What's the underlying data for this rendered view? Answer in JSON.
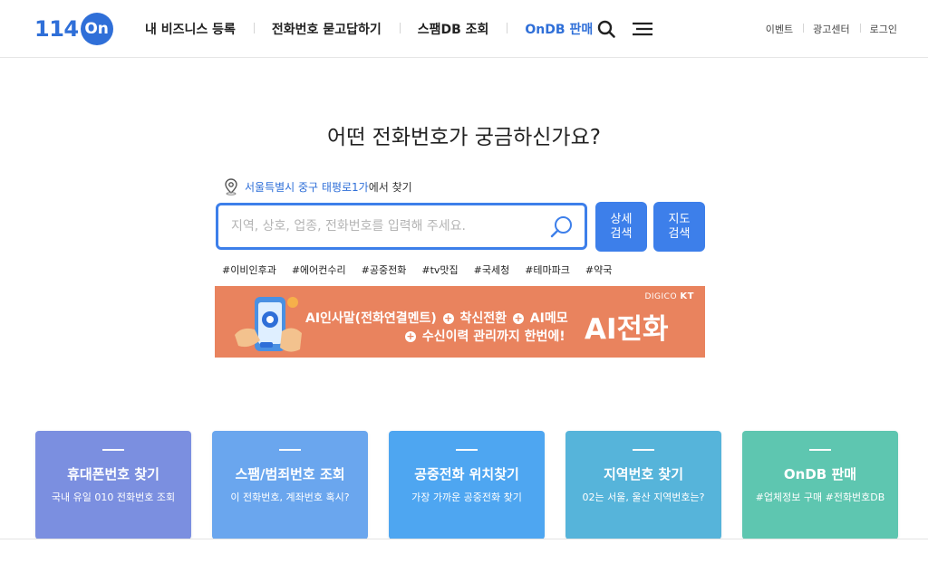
{
  "header": {
    "logo_num": "114",
    "logo_badge": "On",
    "nav": [
      "내 비즈니스 등록",
      "전화번호 묻고답하기",
      "스팸DB 조회",
      "OnDB 판매"
    ],
    "util": [
      "이벤트",
      "광고센터",
      "로그인"
    ],
    "accent_color": "#2f6fd8"
  },
  "hero": {
    "headline": "어떤 전화번호가 궁금하신가요?",
    "location_address": "서울특별시 중구 태평로1가",
    "location_suffix": "에서 찾기",
    "search_placeholder": "지역, 상호, 업종, 전화번호를 입력해 주세요.",
    "detail_btn": [
      "상세",
      "검색"
    ],
    "map_btn": [
      "지도",
      "검색"
    ],
    "tags": [
      "#이비인후과",
      "#에어컨수리",
      "#공중전화",
      "#tv맛집",
      "#국세청",
      "#테마파크",
      "#약국"
    ]
  },
  "banner": {
    "brand_prefix": "DIGICO",
    "brand_name": "KT",
    "line1_a": "AI인사말(전화연결멘트)",
    "line1_b": "착신전환",
    "line1_c": "AI메모",
    "line2_a": "수신이력 관리까지 한번에!",
    "big": "AI전화",
    "bg_color": "#e9835e"
  },
  "cards": [
    {
      "title": "휴대폰번호 찾기",
      "sub": "국내 유일 010 전화번호 조회",
      "color": "#7b8fe0"
    },
    {
      "title": "스팸/범죄번호 조회",
      "sub": "이 전화번호, 계좌번호 혹시?",
      "color": "#6aa6ee"
    },
    {
      "title": "공중전화 위치찾기",
      "sub": "가장 가까운 공중전화 찾기",
      "color": "#4ea6f1"
    },
    {
      "title": "지역번호 찾기",
      "sub": "02는 서울, 울산 지역번호는?",
      "color": "#56b4da"
    },
    {
      "title": "OnDB 판매",
      "sub": "#업체정보 구매 #전화번호DB",
      "color": "#5ec6b0"
    }
  ]
}
